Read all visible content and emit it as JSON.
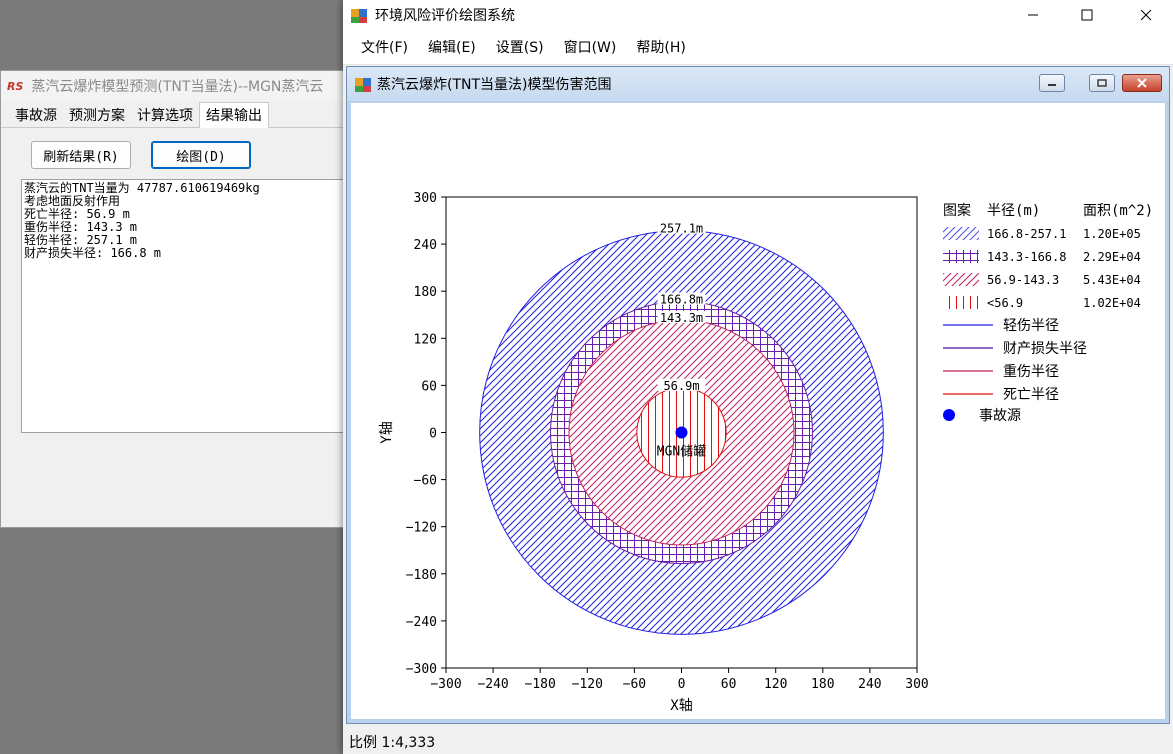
{
  "bg_window": {
    "title": "蒸汽云爆炸模型预测(TNT当量法)--MGN蒸汽云",
    "app_icon_text": "RS",
    "tabs": [
      "事故源",
      "预测方案",
      "计算选项",
      "结果输出"
    ],
    "active_tab": "结果输出",
    "refresh_button": "刷新结果(R)",
    "plot_button": "绘图(D)",
    "output_lines": [
      "蒸汽云的TNT当量为 47787.610619469kg",
      "考虑地面反射作用",
      "死亡半径: 56.9 m",
      "重伤半径: 143.3 m",
      "轻伤半径: 257.1 m",
      "财产损失半径: 166.8 m"
    ]
  },
  "main_window": {
    "title": "环境风险评价绘图系统",
    "menus": [
      "文件(F)",
      "编辑(E)",
      "设置(S)",
      "窗口(W)",
      "帮助(H)"
    ],
    "child_title": "蒸汽云爆炸(TNT当量法)模型伤害范围",
    "status": "比例 1:4,333"
  },
  "chart_data": {
    "type": "concentric-circles",
    "xlabel": "X轴",
    "ylabel": "Y轴",
    "xlim": [
      -300,
      300
    ],
    "ylim": [
      -300,
      300
    ],
    "ticks": [
      -300,
      -240,
      -180,
      -120,
      -60,
      0,
      60,
      120,
      180,
      240,
      300
    ],
    "source": {
      "x": 0,
      "y": 0,
      "label": "MGN储罐",
      "color": "#0000ff"
    },
    "circles": [
      {
        "radius": 257.1,
        "label": "257.1m",
        "color": "#2020e0",
        "hatch": "diag"
      },
      {
        "radius": 166.8,
        "label": "166.8m",
        "color": "#6a1fa8",
        "hatch": "grid"
      },
      {
        "radius": 143.3,
        "label": "143.3m",
        "color": "#c02060",
        "hatch": "diag"
      },
      {
        "radius": 56.9,
        "label": "56.9m",
        "color": "#e01010",
        "hatch": "vert"
      }
    ],
    "legend": {
      "headers": [
        "图案",
        "半径(m)",
        "面积(m^2)"
      ],
      "pattern_rows": [
        {
          "range": "166.8-257.1",
          "area": "1.20E+05",
          "color": "#4a4af0",
          "hatch": "diag"
        },
        {
          "range": "143.3-166.8",
          "area": "2.29E+04",
          "color": "#6a1fa8",
          "hatch": "grid"
        },
        {
          "range": "56.9-143.3",
          "area": "5.43E+04",
          "color": "#c02060",
          "hatch": "diag"
        },
        {
          "range": "<56.9",
          "area": "1.02E+04",
          "color": "#e01010",
          "hatch": "vert"
        }
      ],
      "line_rows": [
        {
          "label": "轻伤半径",
          "color": "#2020e0"
        },
        {
          "label": "财产损失半径",
          "color": "#4b0fa0"
        },
        {
          "label": "重伤半径",
          "color": "#c02060"
        },
        {
          "label": "死亡半径",
          "color": "#e01010"
        }
      ],
      "point_row": {
        "label": "事故源",
        "color": "#0000ff"
      }
    }
  }
}
